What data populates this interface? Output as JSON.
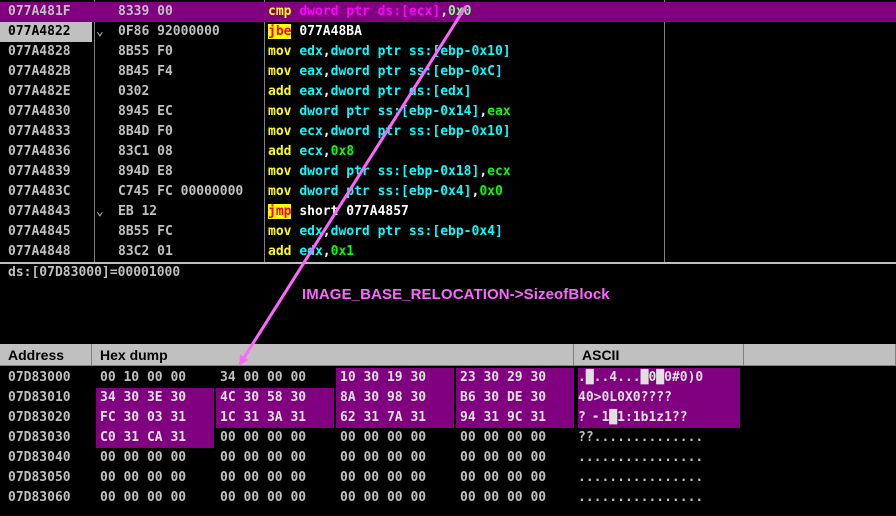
{
  "disassembly": [
    {
      "addr": "077A481F",
      "jmark": "",
      "hex": "8339 00",
      "mnemonic": "cmp",
      "kind": "plain",
      "ops": [
        [
          "dword ptr ds:[ecx]",
          "mem"
        ],
        [
          ",",
          "plain"
        ],
        [
          "0x0",
          "num"
        ]
      ],
      "selected": true,
      "current": false
    },
    {
      "addr": "077A4822",
      "jmark": "⌄",
      "hex": "0F86 92000000",
      "mnemonic": "jbe",
      "kind": "jcc",
      "ops": [
        [
          "077A48BA",
          "plain"
        ]
      ],
      "selected": false,
      "current": true
    },
    {
      "addr": "077A4828",
      "jmark": "",
      "hex": "8B55 F0",
      "mnemonic": "mov",
      "kind": "plain",
      "ops": [
        [
          "edx",
          "reg"
        ],
        [
          ",",
          "plain"
        ],
        [
          "dword ptr ss:[ebp-0x10]",
          "mem"
        ]
      ],
      "selected": false,
      "current": false
    },
    {
      "addr": "077A482B",
      "jmark": "",
      "hex": "8B45 F4",
      "mnemonic": "mov",
      "kind": "plain",
      "ops": [
        [
          "eax",
          "reg"
        ],
        [
          ",",
          "plain"
        ],
        [
          "dword ptr ss:[ebp-0xC]",
          "mem"
        ]
      ],
      "selected": false,
      "current": false
    },
    {
      "addr": "077A482E",
      "jmark": "",
      "hex": "0302",
      "mnemonic": "add",
      "kind": "plain",
      "ops": [
        [
          "eax",
          "reg"
        ],
        [
          ",",
          "plain"
        ],
        [
          "dword ptr ds:[edx]",
          "mem"
        ]
      ],
      "selected": false,
      "current": false
    },
    {
      "addr": "077A4830",
      "jmark": "",
      "hex": "8945 EC",
      "mnemonic": "mov",
      "kind": "plain",
      "ops": [
        [
          "dword ptr ss:[ebp-0x14]",
          "mem"
        ],
        [
          ",",
          "plain"
        ],
        [
          "eax",
          "num"
        ]
      ],
      "selected": false,
      "current": false
    },
    {
      "addr": "077A4833",
      "jmark": "",
      "hex": "8B4D F0",
      "mnemonic": "mov",
      "kind": "plain",
      "ops": [
        [
          "ecx",
          "reg"
        ],
        [
          ",",
          "plain"
        ],
        [
          "dword ptr ss:[ebp-0x10]",
          "mem"
        ]
      ],
      "selected": false,
      "current": false
    },
    {
      "addr": "077A4836",
      "jmark": "",
      "hex": "83C1 08",
      "mnemonic": "add",
      "kind": "plain",
      "ops": [
        [
          "ecx",
          "reg"
        ],
        [
          ",",
          "plain"
        ],
        [
          "0x8",
          "num"
        ]
      ],
      "selected": false,
      "current": false
    },
    {
      "addr": "077A4839",
      "jmark": "",
      "hex": "894D E8",
      "mnemonic": "mov",
      "kind": "plain",
      "ops": [
        [
          "dword ptr ss:[ebp-0x18]",
          "mem"
        ],
        [
          ",",
          "plain"
        ],
        [
          "ecx",
          "num"
        ]
      ],
      "selected": false,
      "current": false
    },
    {
      "addr": "077A483C",
      "jmark": "",
      "hex": "C745 FC 00000000",
      "mnemonic": "mov",
      "kind": "plain",
      "ops": [
        [
          "dword ptr ss:[ebp-0x4]",
          "mem"
        ],
        [
          ",",
          "plain"
        ],
        [
          "0x0",
          "num"
        ]
      ],
      "selected": false,
      "current": false
    },
    {
      "addr": "077A4843",
      "jmark": "⌄",
      "hex": "EB 12",
      "mnemonic": "jmp",
      "kind": "jcc",
      "ops": [
        [
          "short 077A4857",
          "plain"
        ]
      ],
      "selected": false,
      "current": false
    },
    {
      "addr": "077A4845",
      "jmark": "",
      "hex": "8B55 FC",
      "mnemonic": "mov",
      "kind": "plain",
      "ops": [
        [
          "edx",
          "reg"
        ],
        [
          ",",
          "plain"
        ],
        [
          "dword ptr ss:[ebp-0x4]",
          "mem"
        ]
      ],
      "selected": false,
      "current": false
    },
    {
      "addr": "077A4848",
      "jmark": "",
      "hex": "83C2 01",
      "mnemonic": "add",
      "kind": "plain",
      "ops": [
        [
          "edx",
          "reg"
        ],
        [
          ",",
          "plain"
        ],
        [
          "0x1",
          "num"
        ]
      ],
      "selected": false,
      "current": false
    }
  ],
  "info": {
    "line": "ds:[07D83000]=00001000",
    "annotation": "IMAGE_BASE_RELOCATION->SizeofBlock"
  },
  "dump": {
    "headers": {
      "address": "Address",
      "hex": "Hex dump",
      "ascii": "ASCII"
    },
    "rows": [
      {
        "addr": "07D83000",
        "groups": [
          "00 10 00 00",
          "34 00 00 00",
          "10 30 19 30",
          "23 30 29 30"
        ],
        "ascii": ".█..4...█0█0#0)0",
        "hl": [
          false,
          false,
          true,
          true
        ],
        "ascii_hl": true
      },
      {
        "addr": "07D83010",
        "groups": [
          "34 30 3E 30",
          "4C 30 58 30",
          "8A 30 98 30",
          "B6 30 DE 30"
        ],
        "ascii": "40>0L0X0????",
        "hl": [
          true,
          true,
          true,
          true
        ],
        "ascii_hl": true
      },
      {
        "addr": "07D83020",
        "groups": [
          "FC 30 03 31",
          "1C 31 3A 31",
          "62 31 7A 31",
          "94 31 9C 31"
        ],
        "ascii": "? ╸1█1:1b1z1??",
        "hl": [
          true,
          true,
          true,
          true
        ],
        "ascii_hl": true
      },
      {
        "addr": "07D83030",
        "groups": [
          "C0 31 CA 31",
          "00 00 00 00",
          "00 00 00 00",
          "00 00 00 00"
        ],
        "ascii": "??..............",
        "hl": [
          true,
          false,
          false,
          false
        ],
        "ascii_hl": false
      },
      {
        "addr": "07D83040",
        "groups": [
          "00 00 00 00",
          "00 00 00 00",
          "00 00 00 00",
          "00 00 00 00"
        ],
        "ascii": "................",
        "hl": [
          false,
          false,
          false,
          false
        ],
        "ascii_hl": false
      },
      {
        "addr": "07D83050",
        "groups": [
          "00 00 00 00",
          "00 00 00 00",
          "00 00 00 00",
          "00 00 00 00"
        ],
        "ascii": "................",
        "hl": [
          false,
          false,
          false,
          false
        ],
        "ascii_hl": false
      },
      {
        "addr": "07D83060",
        "groups": [
          "00 00 00 00",
          "00 00 00 00",
          "00 00 00 00",
          "00 00 00 00"
        ],
        "ascii": "................",
        "hl": [
          false,
          false,
          false,
          false
        ],
        "ascii_hl": false
      }
    ]
  },
  "colors": {
    "selection": "#800080",
    "annotation": "#ff66ff",
    "arrow": "#ff66ff"
  }
}
